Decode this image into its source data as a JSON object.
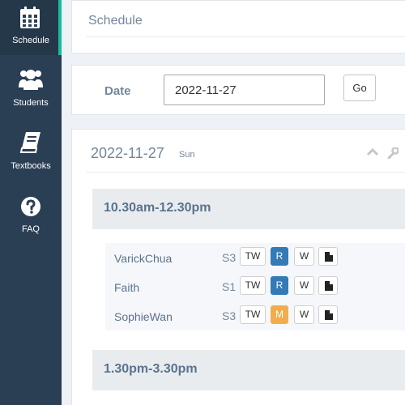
{
  "sidebar": {
    "items": [
      {
        "label": "Schedule",
        "icon": "calendar-icon",
        "active": true
      },
      {
        "label": "Students",
        "icon": "users-icon",
        "active": false
      },
      {
        "label": "Textbooks",
        "icon": "book-icon",
        "active": false
      },
      {
        "label": "FAQ",
        "icon": "question-circle-icon",
        "active": false
      }
    ]
  },
  "header": {
    "title": "Schedule"
  },
  "date_form": {
    "label": "Date",
    "value": "2022-11-27",
    "go_label": "Go"
  },
  "schedule": {
    "date": "2022-11-27",
    "day_of_week": "Sun",
    "slots": [
      {
        "time": "10.30am-12.30pm",
        "students": [
          {
            "name": "VarickChua",
            "level": "S3",
            "tw": "TW",
            "status": "R",
            "status_color": "#337ab7",
            "w": "W"
          },
          {
            "name": "Faith",
            "level": "S1",
            "tw": "TW",
            "status": "R",
            "status_color": "#337ab7",
            "w": "W"
          },
          {
            "name": "SophieWan",
            "level": "S3",
            "tw": "TW",
            "status": "M",
            "status_color": "#f0ad4e",
            "w": "W"
          }
        ]
      },
      {
        "time": "1.30pm-3.30pm",
        "students": []
      }
    ]
  },
  "colors": {
    "sidebar_bg": "#2a3f54",
    "active_accent": "#1abb9c",
    "text_muted": "#73879c"
  }
}
